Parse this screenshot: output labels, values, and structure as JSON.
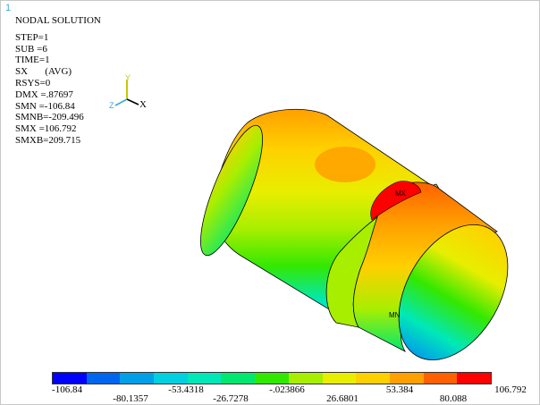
{
  "window": {
    "number": "1"
  },
  "info": {
    "title": "NODAL SOLUTION",
    "rows": [
      "STEP=1",
      "SUB =6",
      "TIME=1",
      "SX       (AVG)",
      "RSYS=0",
      "DMX =.87697",
      "SMN =-106.84",
      "SMNB=-209.496",
      "SMX =106.792",
      "SMXB=209.715"
    ]
  },
  "triad": {
    "y_label": "Y",
    "x_label": "X",
    "z_label": "Z"
  },
  "markers": {
    "max_label": "MX",
    "min_label": "MN"
  },
  "legend": {
    "colors": [
      "#0000ff",
      "#0066ee",
      "#00a0e8",
      "#00d0e0",
      "#00e8b8",
      "#00e870",
      "#33e800",
      "#a8ee00",
      "#e8ee00",
      "#ffd000",
      "#ffa000",
      "#ff6000",
      "#ff0000"
    ],
    "labels_top": [
      "-106.84",
      "-53.4318",
      "-.023866",
      "53.384",
      "106.792"
    ],
    "labels_bottom": [
      "-80.1357",
      "-26.7278",
      "26.6801",
      "80.088"
    ]
  }
}
